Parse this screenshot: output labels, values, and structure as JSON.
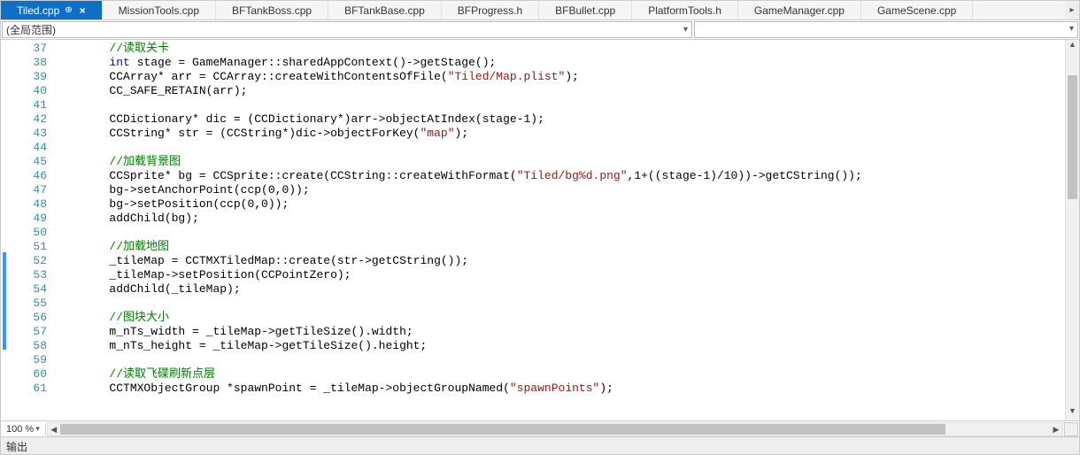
{
  "tabs": [
    {
      "label": "Tiled.cpp",
      "active": true,
      "pinned": true,
      "closeable": true
    },
    {
      "label": "MissionTools.cpp"
    },
    {
      "label": "BFTankBoss.cpp"
    },
    {
      "label": "BFTankBase.cpp"
    },
    {
      "label": "BFProgress.h"
    },
    {
      "label": "BFBullet.cpp"
    },
    {
      "label": "PlatformTools.h"
    },
    {
      "label": "GameManager.cpp"
    },
    {
      "label": "GameScene.cpp"
    }
  ],
  "scope_dropdown": "(全局范围)",
  "zoom": "100 %",
  "output_title": "输出",
  "line_start": 37,
  "code_lines": [
    [
      [
        "cm",
        "//读取关卡"
      ]
    ],
    [
      [
        "kw",
        "int"
      ],
      [
        "plain",
        " stage = GameManager::sharedAppContext()->getStage();"
      ]
    ],
    [
      [
        "plain",
        "CCArray* arr = CCArray::createWithContentsOfFile("
      ],
      [
        "str",
        "\"Tiled/Map.plist\""
      ],
      [
        "plain",
        ");"
      ]
    ],
    [
      [
        "plain",
        "CC_SAFE_RETAIN(arr);"
      ]
    ],
    [],
    [
      [
        "plain",
        "CCDictionary* dic = (CCDictionary*)arr->objectAtIndex(stage-1);"
      ]
    ],
    [
      [
        "plain",
        "CCString* str = (CCString*)dic->objectForKey("
      ],
      [
        "str",
        "\"map\""
      ],
      [
        "plain",
        ");"
      ]
    ],
    [],
    [
      [
        "cm",
        "//加载背景图"
      ]
    ],
    [
      [
        "plain",
        "CCSprite* bg = CCSprite::create(CCString::createWithFormat("
      ],
      [
        "str",
        "\"Tiled/bg%d.png\""
      ],
      [
        "plain",
        ",1+((stage-1)/10))->getCString());"
      ]
    ],
    [
      [
        "plain",
        "bg->setAnchorPoint(ccp(0,0));"
      ]
    ],
    [
      [
        "plain",
        "bg->setPosition(ccp(0,0));"
      ]
    ],
    [
      [
        "plain",
        "addChild(bg);"
      ]
    ],
    [],
    [
      [
        "cm",
        "//加载地图"
      ]
    ],
    [
      [
        "plain",
        "_tileMap = CCTMXTiledMap::create(str->getCString());"
      ]
    ],
    [
      [
        "plain",
        "_tileMap->setPosition(CCPointZero);"
      ]
    ],
    [
      [
        "plain",
        "addChild(_tileMap);"
      ]
    ],
    [],
    [
      [
        "cm",
        "//图块大小"
      ]
    ],
    [
      [
        "plain",
        "m_nTs_width = _tileMap->getTileSize().width;"
      ]
    ],
    [
      [
        "plain",
        "m_nTs_height = _tileMap->getTileSize().height;"
      ]
    ],
    [],
    [
      [
        "cm",
        "//读取飞碟刷新点层"
      ]
    ],
    [
      [
        "plain",
        "CCTMXObjectGroup *spawnPoint = _tileMap->objectGroupNamed("
      ],
      [
        "str",
        "\"spawnPoints\""
      ],
      [
        "plain",
        ");"
      ]
    ]
  ],
  "indent": "        "
}
